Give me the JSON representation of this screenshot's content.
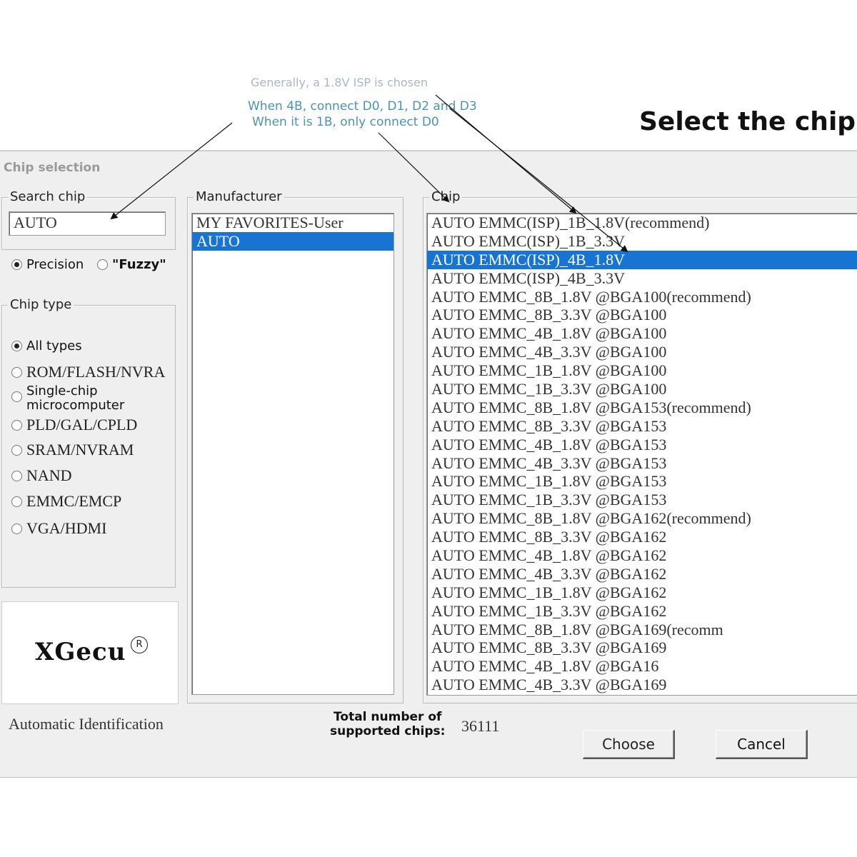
{
  "annotations": {
    "line1": "Generally, a 1.8V ISP is chosen",
    "line2": "When 4B, connect D0, D1, D2 and D3",
    "line3": "When it is 1B, only connect D0"
  },
  "headline": "Select the chip",
  "dialog": {
    "title": "Chip selection",
    "search": {
      "legend": "Search chip",
      "value": "AUTO",
      "modes": [
        {
          "label": "Precision",
          "checked": true
        },
        {
          "label": "\"Fuzzy\"",
          "checked": false
        }
      ]
    },
    "chip_type": {
      "legend": "Chip type",
      "options": [
        {
          "label": "All types",
          "checked": true
        },
        {
          "label": "ROM/FLASH/NVRA",
          "checked": false
        },
        {
          "label": "Single-chip",
          "label2": "microcomputer",
          "checked": false
        },
        {
          "label": "PLD/GAL/CPLD",
          "checked": false
        },
        {
          "label": "SRAM/NVRAM",
          "checked": false
        },
        {
          "label": "NAND",
          "checked": false
        },
        {
          "label": "EMMC/EMCP",
          "checked": false
        },
        {
          "label": "VGA/HDMI",
          "checked": false
        }
      ]
    },
    "logo": "XGecu",
    "manufacturer": {
      "legend": "Manufacturer",
      "items": [
        "MY FAVORITES-User",
        "AUTO"
      ],
      "selected_index": 1
    },
    "chip": {
      "legend": "Chip",
      "selected_index": 2,
      "items": [
        "AUTO EMMC(ISP)_1B_1.8V(recommend)",
        "AUTO EMMC(ISP)_1B_3.3V",
        "AUTO EMMC(ISP)_4B_1.8V",
        "AUTO EMMC(ISP)_4B_3.3V",
        "AUTO EMMC_8B_1.8V @BGA100(recommend)",
        "AUTO EMMC_8B_3.3V @BGA100",
        "AUTO EMMC_4B_1.8V @BGA100",
        "AUTO EMMC_4B_3.3V @BGA100",
        "AUTO EMMC_1B_1.8V @BGA100",
        "AUTO EMMC_1B_3.3V @BGA100",
        "AUTO EMMC_8B_1.8V @BGA153(recommend)",
        "AUTO EMMC_8B_3.3V @BGA153",
        "AUTO EMMC_4B_1.8V @BGA153",
        "AUTO EMMC_4B_3.3V @BGA153",
        "AUTO EMMC_1B_1.8V @BGA153",
        "AUTO EMMC_1B_3.3V @BGA153",
        "AUTO EMMC_8B_1.8V @BGA162(recommend)",
        "AUTO EMMC_8B_3.3V @BGA162",
        "AUTO EMMC_4B_1.8V @BGA162",
        "AUTO EMMC_4B_3.3V @BGA162",
        "AUTO EMMC_1B_1.8V @BGA162",
        "AUTO EMMC_1B_3.3V @BGA162",
        "AUTO EMMC_8B_1.8V @BGA169(recomm",
        "AUTO EMMC_8B_3.3V @BGA169",
        "AUTO EMMC_4B_1.8V @BGA16",
        "AUTO EMMC_4B_3.3V @BGA169"
      ]
    },
    "status": "Automatic Identification",
    "total_label_1": "Total number of",
    "total_label_2": "supported chips:",
    "total_value": "36111",
    "buttons": {
      "choose": "Choose",
      "cancel": "Cancel"
    }
  },
  "colors": {
    "selection": "#1874d2",
    "annotation_grey": "#a9b7c0",
    "annotation_blue": "#4b93b3",
    "dialog_bg": "#efefef"
  }
}
